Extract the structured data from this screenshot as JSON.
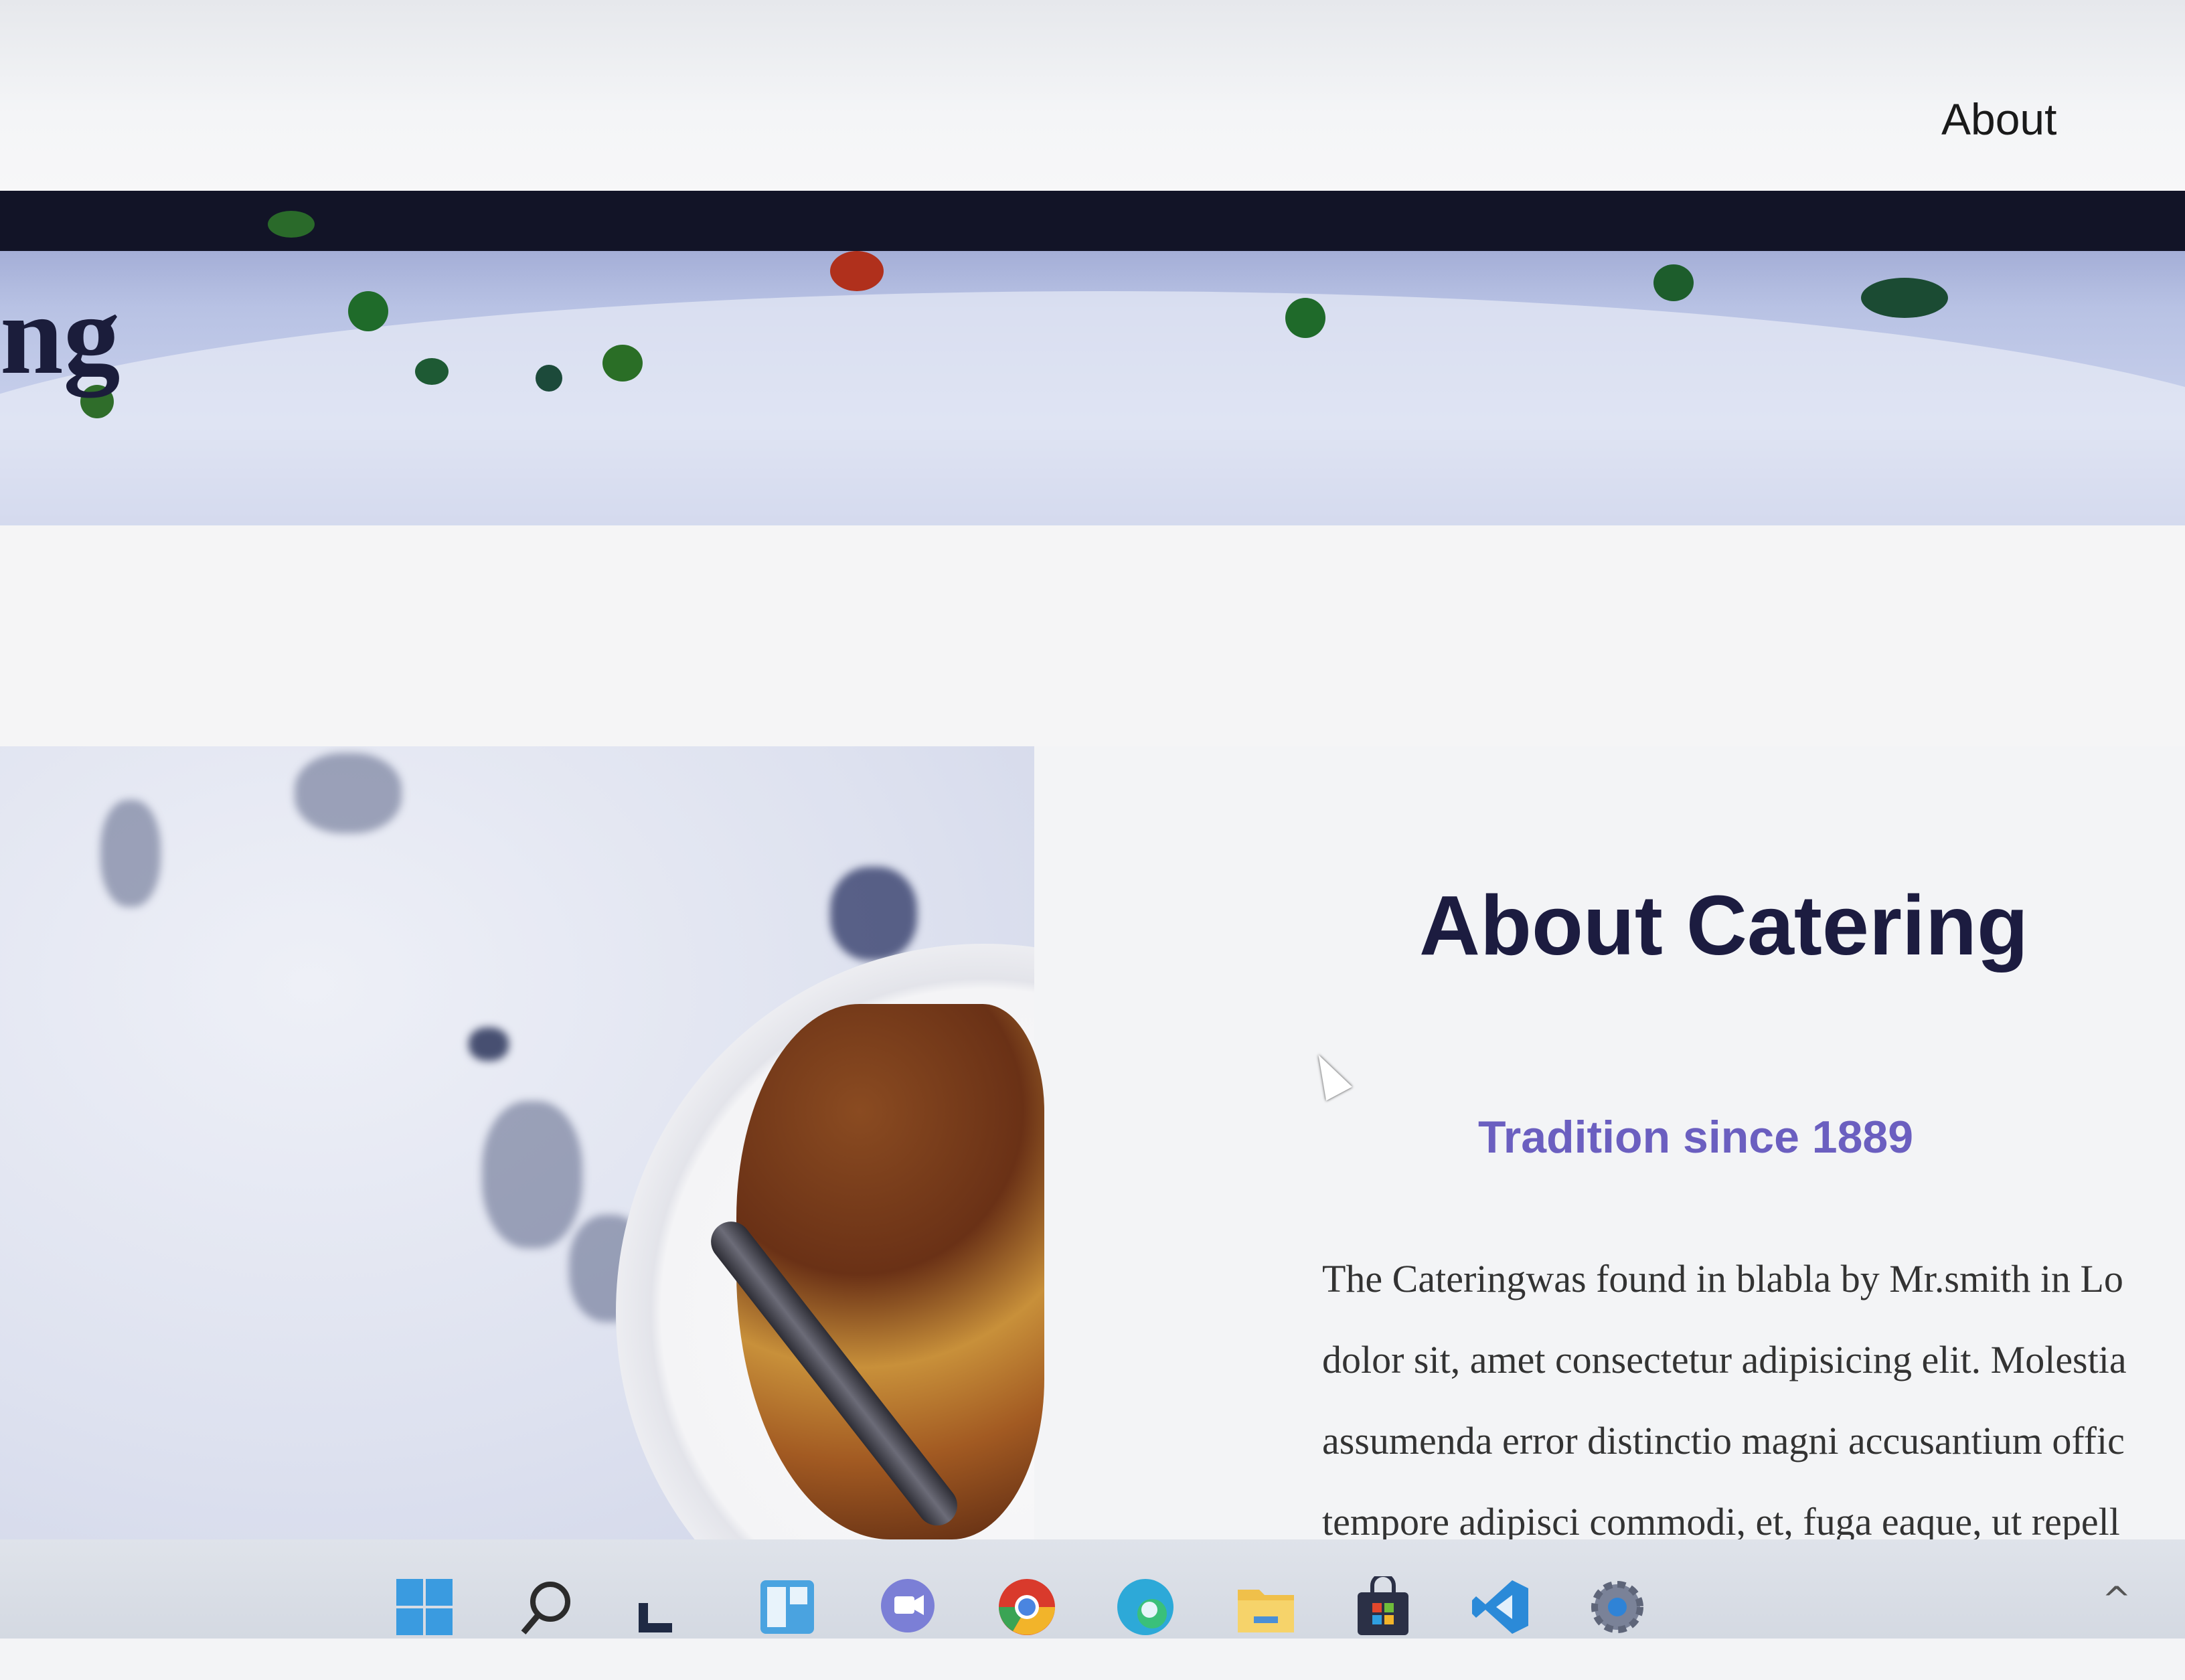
{
  "nav": {
    "about_label": "About"
  },
  "hero": {
    "title_fragment": "ng"
  },
  "about": {
    "title": "About Catering",
    "subtitle": "Tradition since 1889",
    "paragraph_lines": [
      "The Cateringwas found in blabla by Mr.smith in Lo",
      "dolor sit, amet consectetur adipisicing elit. Molestia",
      "assumenda error distinctio magni accusantium offic",
      "tempore adipisci commodi, et, fuga eaque, ut repell"
    ]
  },
  "taskbar": {
    "icons": [
      "windows-start-icon",
      "search-icon",
      "task-view-icon",
      "widgets-icon",
      "chat-icon",
      "chrome-icon",
      "edge-icon",
      "file-explorer-icon",
      "store-icon",
      "vscode-icon",
      "settings-icon"
    ],
    "tray": {
      "chevron": "^"
    }
  },
  "colors": {
    "title": "#1c1c40",
    "subtitle": "#6b5fc0",
    "hero_band": "#121427"
  }
}
